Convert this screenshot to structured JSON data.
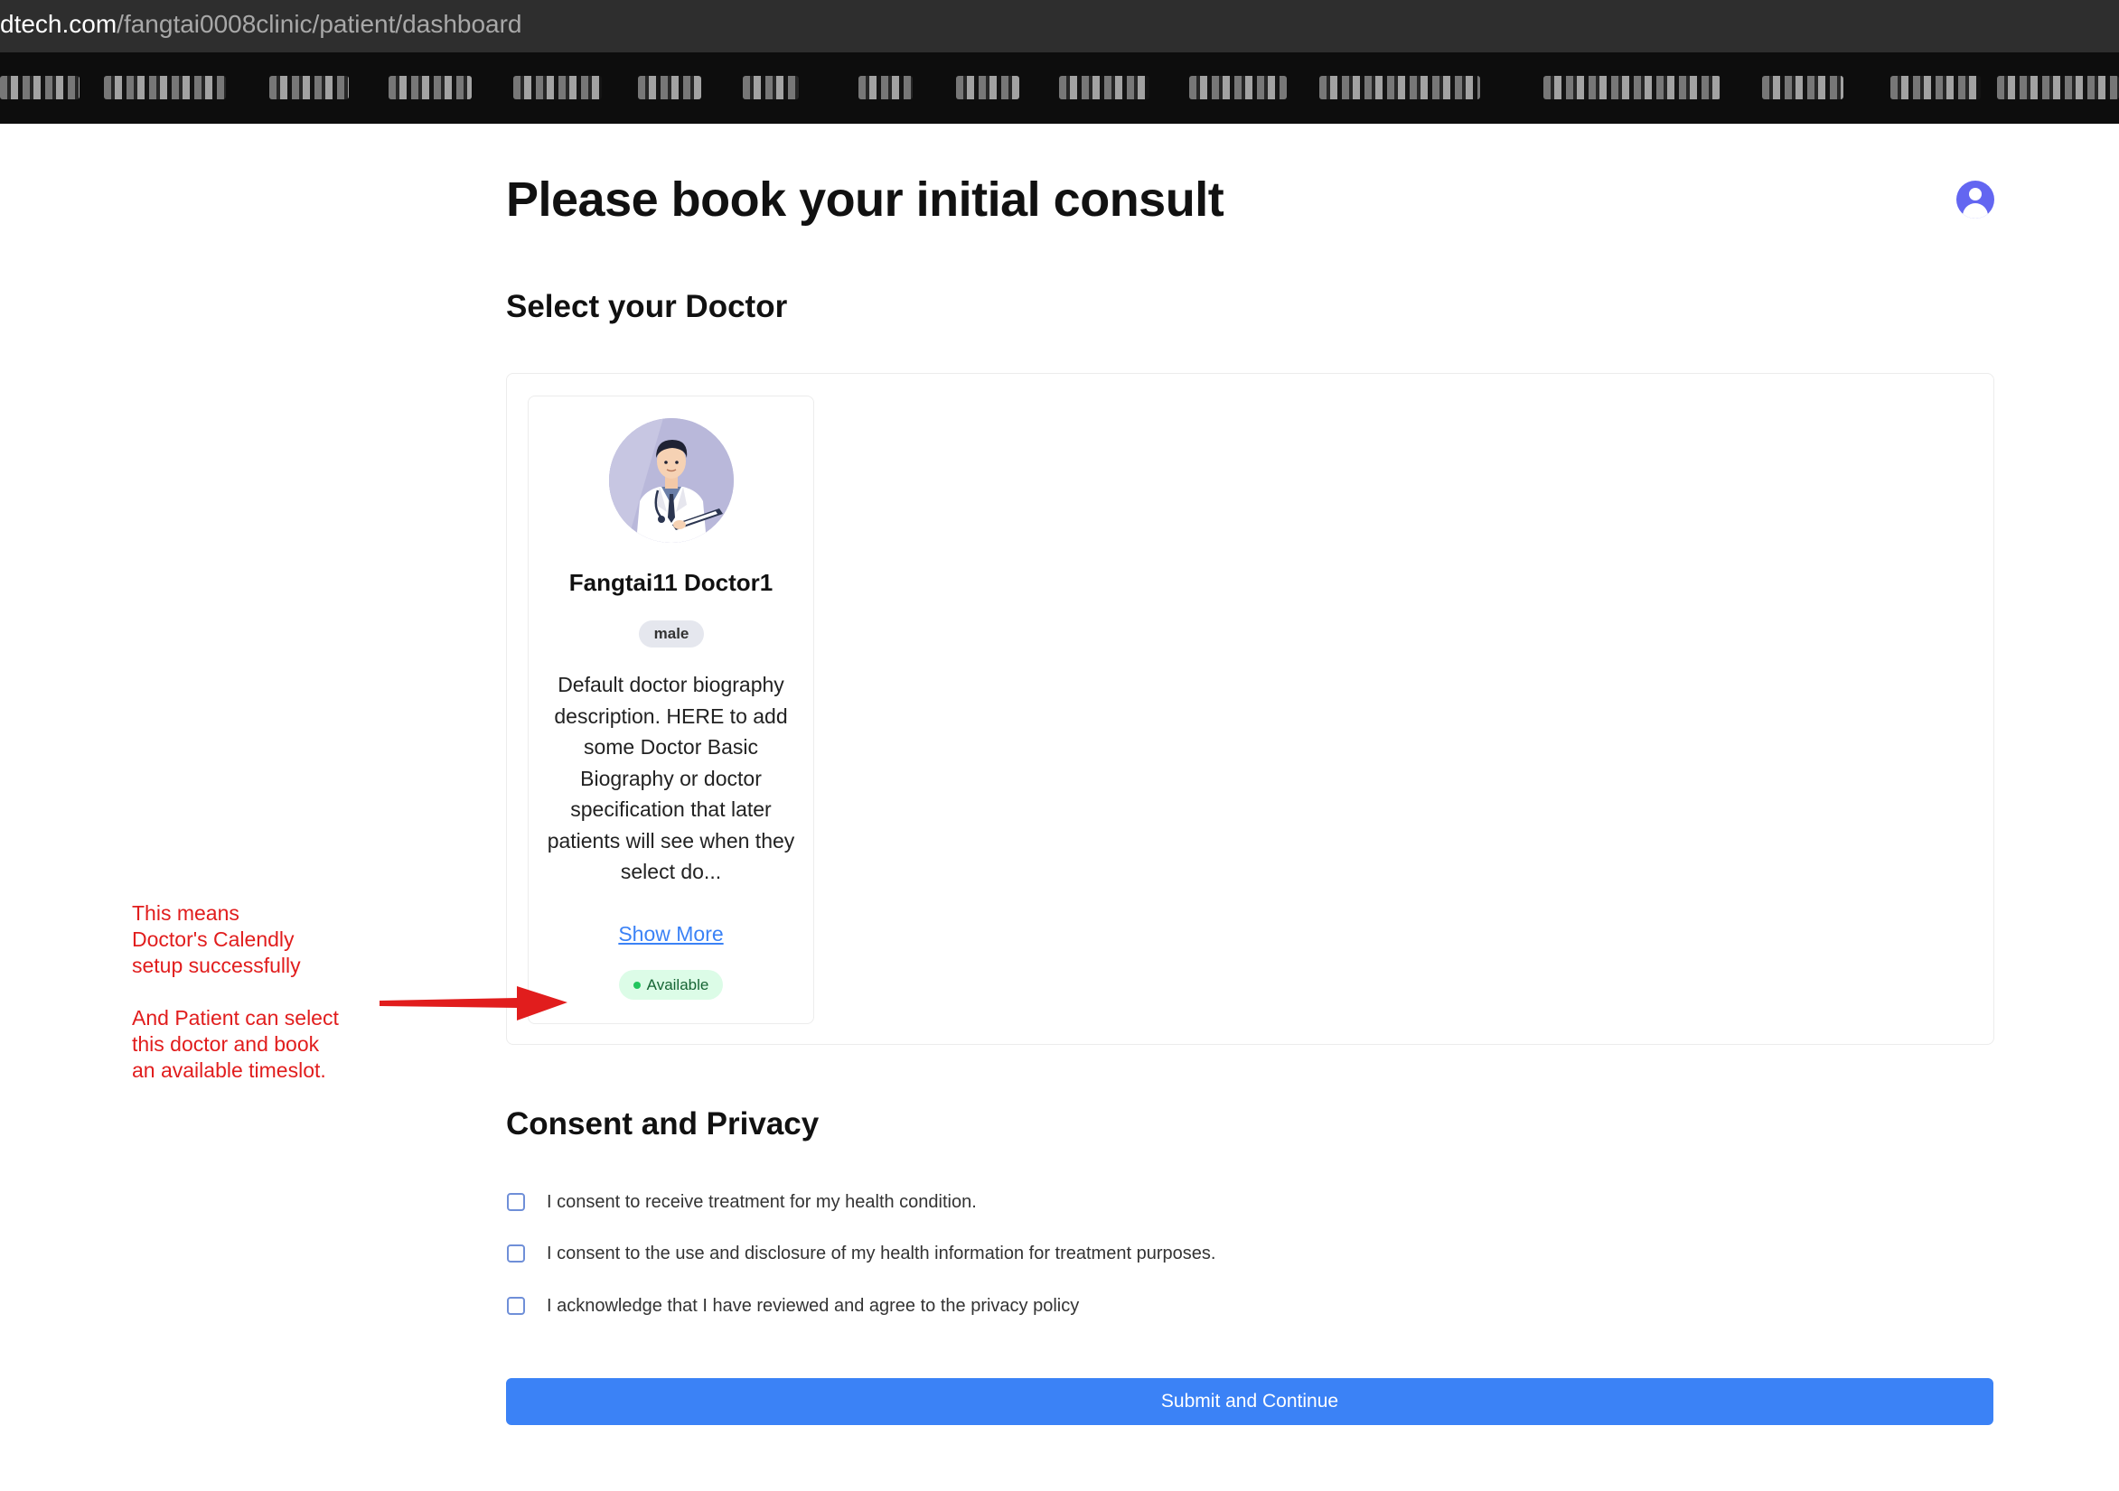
{
  "browser": {
    "url_host": "dtech.com",
    "url_path": "/fangtai0008clinic/patient/dashboard"
  },
  "page": {
    "title": "Please book your initial consult",
    "user_menu_icon": "user-circle-icon",
    "accent_color": "#6366f1"
  },
  "doctor_section": {
    "heading": "Select your Doctor",
    "doctors": [
      {
        "name": "Fangtai11 Doctor1",
        "gender": "male",
        "bio": "Default doctor biography description. HERE to add some Doctor Basic Biography or doctor specification that later patients will see when they select do...",
        "show_more_label": "Show More",
        "status": "Available",
        "status_color": "#22c55e"
      }
    ]
  },
  "annotation": {
    "line1": "This means",
    "line2": "Doctor's Calendly",
    "line3": "setup successfully",
    "line4": "And Patient can select",
    "line5": "this doctor and book",
    "line6": "an available timeslot.",
    "color": "#e11d1d"
  },
  "consent_section": {
    "heading": "Consent and Privacy",
    "items": [
      {
        "label": "I consent to receive treatment for my health condition.",
        "checked": false
      },
      {
        "label": "I consent to the use and disclosure of my health information for treatment purposes.",
        "checked": false
      },
      {
        "label": "I acknowledge that I have reviewed and agree to the privacy policy",
        "checked": false
      }
    ]
  },
  "submit": {
    "label": "Submit and Continue",
    "color": "#3b82f6"
  }
}
